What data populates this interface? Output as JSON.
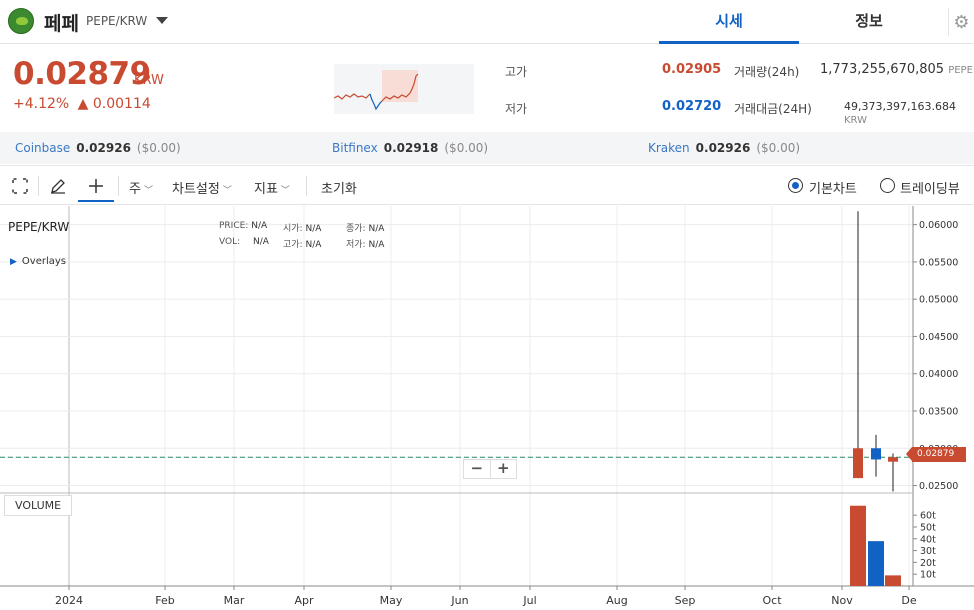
{
  "header": {
    "coin_name": "페페",
    "pair": "PEPE/KRW",
    "tabs": [
      {
        "label": "시세",
        "active": true
      },
      {
        "label": "정보",
        "active": false
      }
    ]
  },
  "ticker": {
    "price": "0.02879",
    "unit": "KRW",
    "change_pct": "+4.12%",
    "change_abs": "▲ 0.00114",
    "high_label": "고가",
    "high": "0.02905",
    "low_label": "저가",
    "low": "0.02720",
    "vol_label": "거래량(24h)",
    "vol": "1,773,255,670,805",
    "vol_unit": "PEPE",
    "amt_label": "거래대금(24H)",
    "amt": "49,373,397,163.684",
    "amt_unit": "KRW"
  },
  "exchanges": [
    {
      "name": "Coinbase",
      "price": "0.02926",
      "krw": "($0.00)"
    },
    {
      "name": "Bitfinex",
      "price": "0.02918",
      "krw": "($0.00)"
    },
    {
      "name": "Kraken",
      "price": "0.02926",
      "krw": "($0.00)"
    }
  ],
  "toolbar": {
    "period": "주",
    "chart_settings": "차트설정",
    "indicators": "지표",
    "reset": "초기화",
    "basic_chart": "기본차트",
    "tradingview": "트레이딩뷰"
  },
  "chart_panel": {
    "symbol": "PEPE/KRW",
    "overlays": "Overlays",
    "info": [
      {
        "k": "PRICE:",
        "v": "N/A"
      },
      {
        "k": "시가:",
        "v": "N/A"
      },
      {
        "k": "종가:",
        "v": "N/A"
      },
      {
        "k": "VOL:",
        "v": "N/A"
      },
      {
        "k": "고가:",
        "v": "N/A"
      },
      {
        "k": "저가:",
        "v": "N/A"
      }
    ],
    "volume_label": "VOLUME",
    "current_price_tag": "0.02879",
    "zoom_out": "−",
    "zoom_in": "+"
  },
  "colors": {
    "up": "#c84a31",
    "down": "#1261c4",
    "grid": "#ececec"
  },
  "chart_data": {
    "type": "candlestick",
    "ylim": [
      0.024,
      0.0625
    ],
    "y_ticks": [
      "0.06000",
      "0.05500",
      "0.05000",
      "0.04500",
      "0.04000",
      "0.03500",
      "0.03000",
      "0.02500"
    ],
    "volume_ticks": [
      "60t",
      "50t",
      "40t",
      "30t",
      "20t",
      "10t"
    ],
    "x_labels": [
      "2024",
      "Feb",
      "Mar",
      "Apr",
      "May",
      "Jun",
      "Jul",
      "Aug",
      "Sep",
      "Oct",
      "Nov",
      "De"
    ],
    "current_price": 0.02879,
    "candles": [
      {
        "open": 0.026,
        "close": 0.03,
        "high": 0.0618,
        "low": 0.026,
        "volume": 68
      },
      {
        "open": 0.03,
        "close": 0.0285,
        "high": 0.0318,
        "low": 0.0262,
        "volume": 38
      },
      {
        "open": 0.0288,
        "close": 0.0282,
        "high": 0.0293,
        "low": 0.0242,
        "volume": 9
      }
    ]
  }
}
